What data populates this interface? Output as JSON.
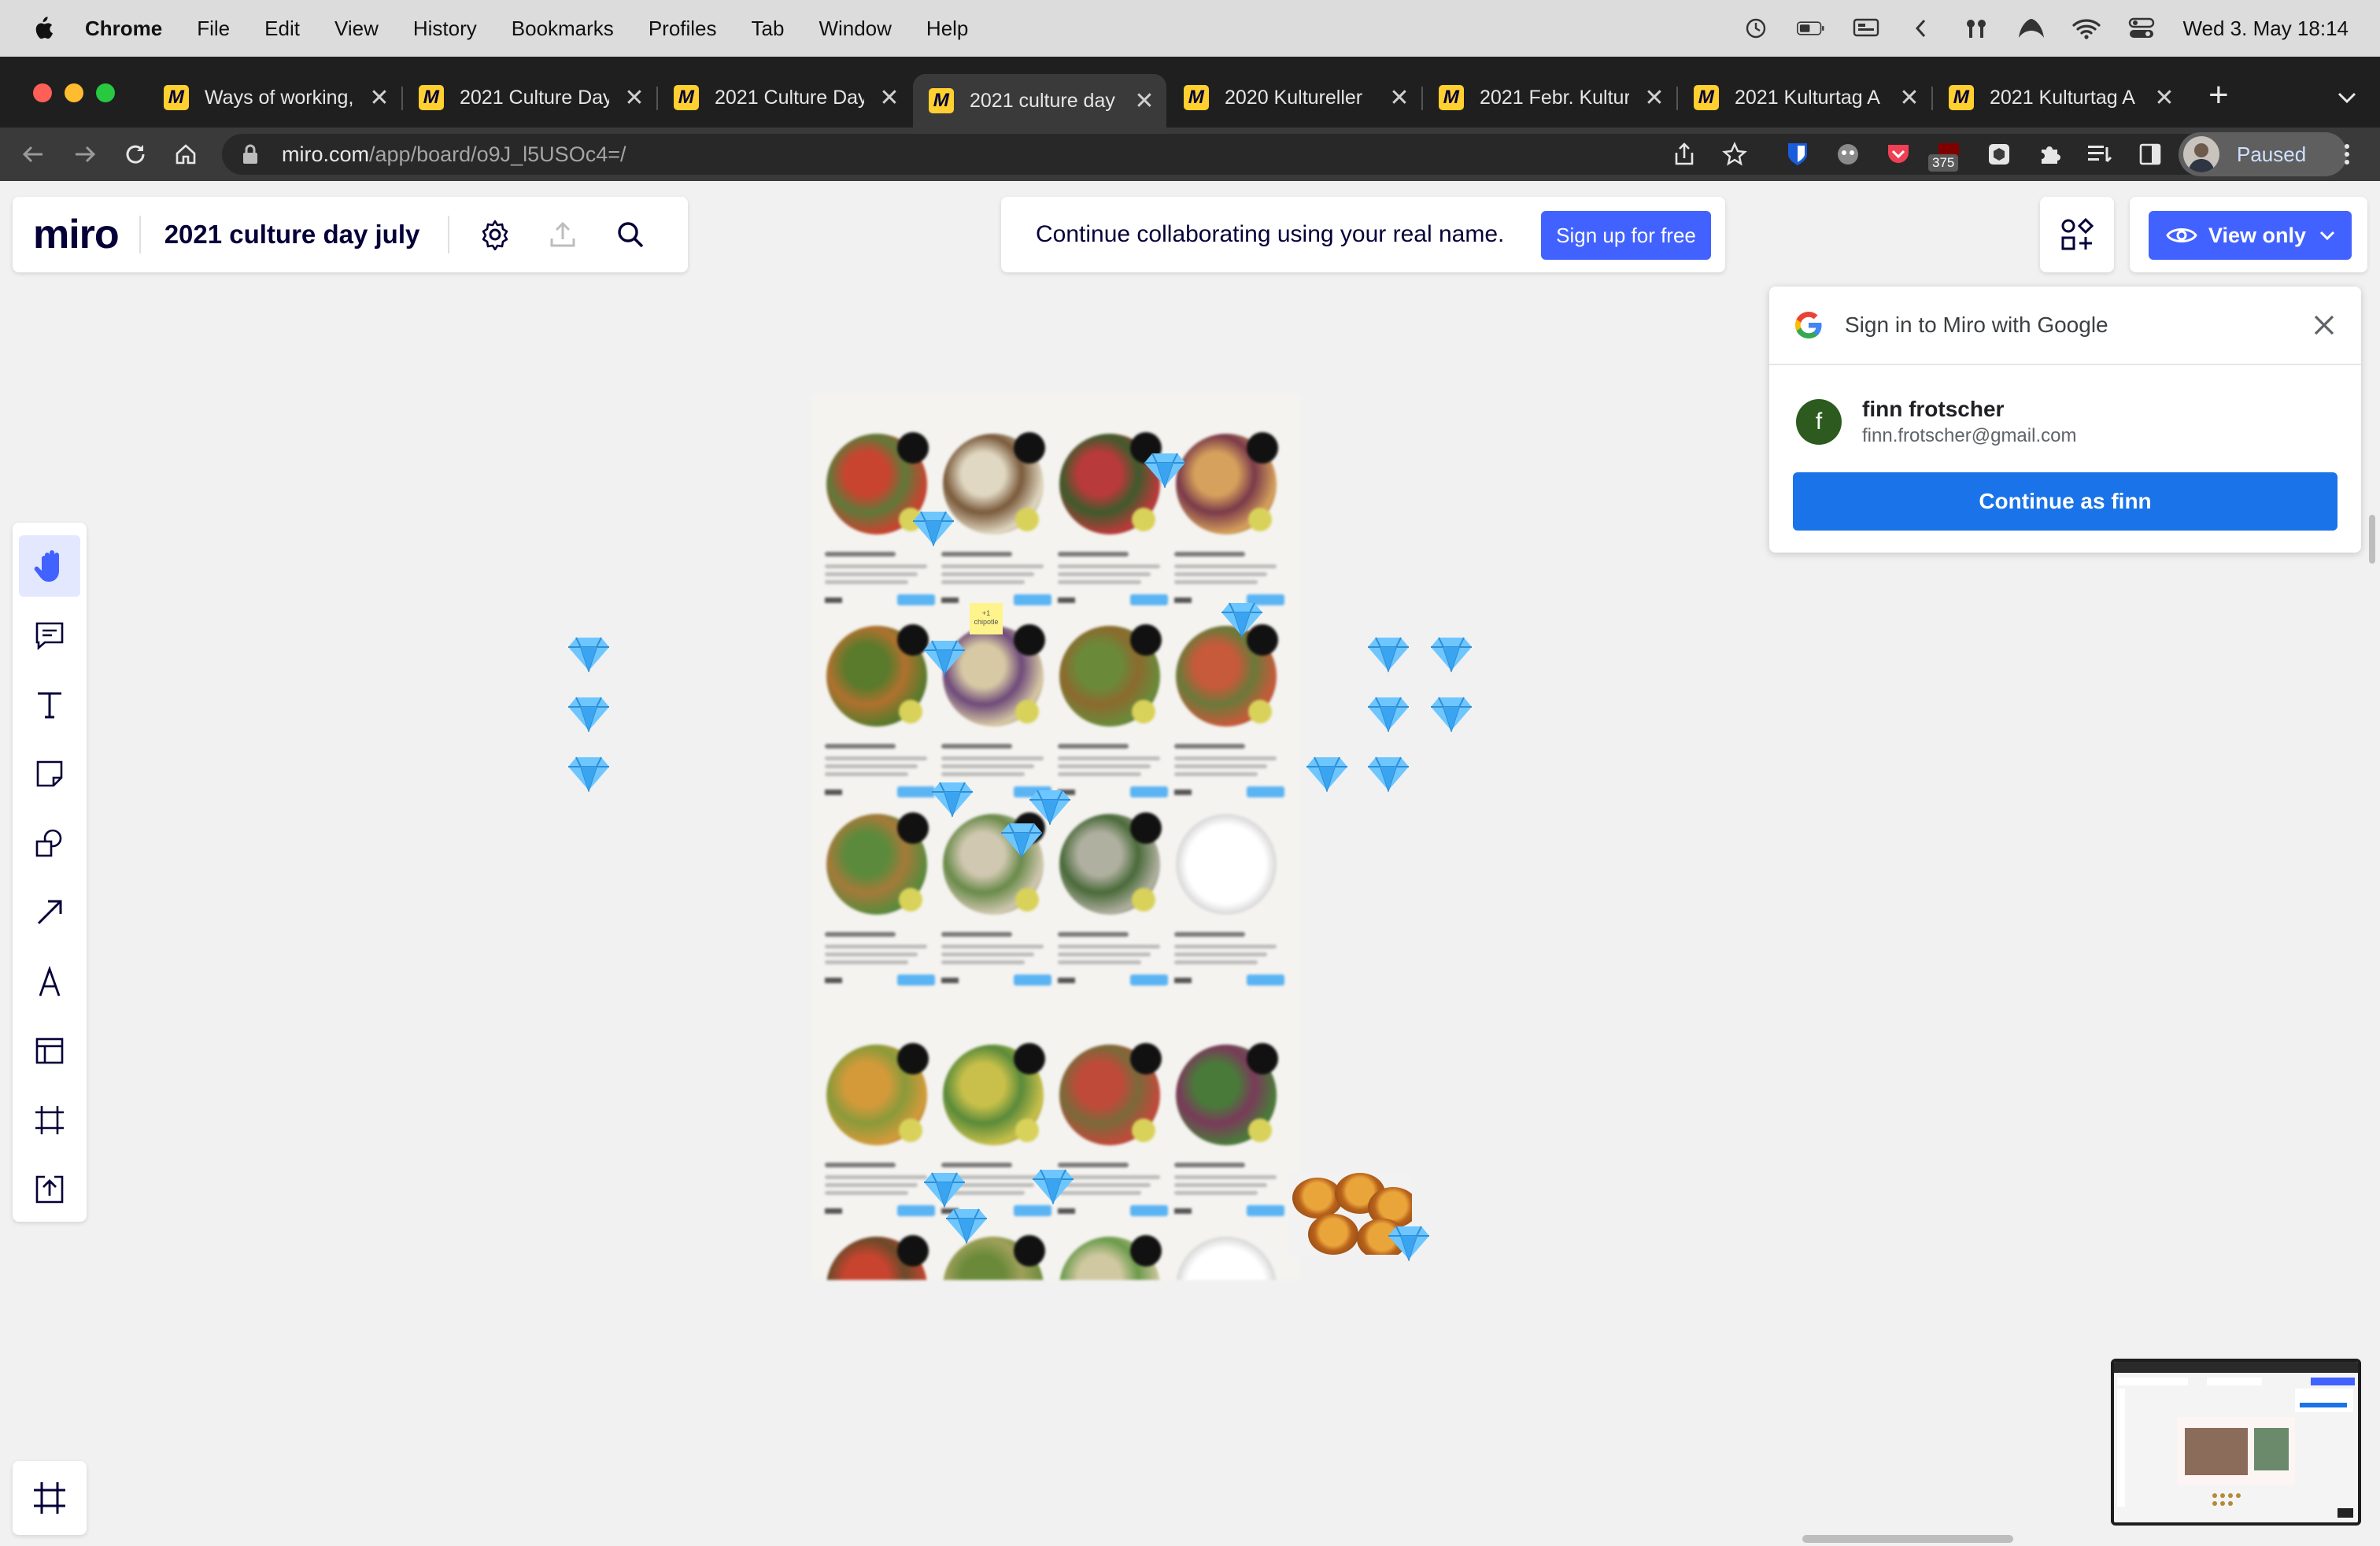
{
  "menubar": {
    "app": "Chrome",
    "items": [
      "File",
      "Edit",
      "View",
      "History",
      "Bookmarks",
      "Profiles",
      "Tab",
      "Window",
      "Help"
    ],
    "clock": "Wed 3. May  18:14"
  },
  "tabs": [
    {
      "title": "Ways of working,"
    },
    {
      "title": "2021 Culture Day"
    },
    {
      "title": "2021 Culture Day"
    },
    {
      "title": "2021 culture day"
    },
    {
      "title": "2020 Kultureller"
    },
    {
      "title": "2021 Febr. Kultur"
    },
    {
      "title": "2021 Kulturtag A"
    },
    {
      "title": "2021 Kulturtag A"
    }
  ],
  "toolbar": {
    "url_host": "miro.com",
    "url_path": "/app/board/o9J_l5USOc4=/",
    "extension_badge": "375",
    "profile_status": "Paused"
  },
  "miro": {
    "logo": "miro",
    "board_title": "2021 culture day july",
    "signup_message": "Continue collaborating using your real name.",
    "signup_button": "Sign up for free",
    "view_button": "View only"
  },
  "google": {
    "title": "Sign in to Miro with Google",
    "account_initial": "f",
    "account_name": "finn frotscher",
    "account_email": "finn.frotscher@gmail.com",
    "continue_button": "Continue as finn"
  },
  "sticky_note": "+1 chipotle",
  "colors": {
    "miro_blue": "#4262ff",
    "google_blue": "#1a73e8",
    "miro_yellow": "#ffd02f",
    "miro_navy": "#050038"
  }
}
